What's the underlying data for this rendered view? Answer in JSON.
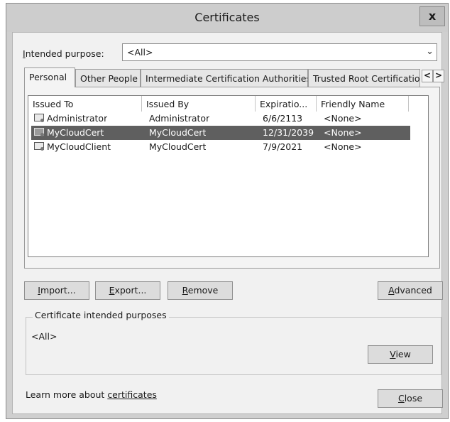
{
  "window": {
    "title": "Certificates",
    "close_glyph": "x"
  },
  "intended_purpose": {
    "label": "Intended purpose:",
    "value": "<All>"
  },
  "tabs": [
    {
      "label": "Personal",
      "active": true
    },
    {
      "label": "Other People",
      "active": false
    },
    {
      "label": "Intermediate Certification Authorities",
      "active": false
    },
    {
      "label": "Trusted Root Certification",
      "active": false
    }
  ],
  "tab_nav": {
    "prev": "<",
    "next": ">"
  },
  "table": {
    "columns": [
      "Issued To",
      "Issued By",
      "Expiratio...",
      "Friendly Name"
    ],
    "rows": [
      {
        "issued_to": "Administrator",
        "issued_by": "Administrator",
        "expiration": "6/6/2113",
        "friendly_name": "<None>",
        "selected": false
      },
      {
        "issued_to": "MyCloudCert",
        "issued_by": "MyCloudCert",
        "expiration": "12/31/2039",
        "friendly_name": "<None>",
        "selected": true
      },
      {
        "issued_to": "MyCloudClient",
        "issued_by": "MyCloudCert",
        "expiration": "7/9/2021",
        "friendly_name": "<None>",
        "selected": false
      }
    ]
  },
  "buttons": {
    "import": "Import...",
    "export": "Export...",
    "remove": "Remove",
    "advanced": "Advanced",
    "view": "View",
    "close": "Close"
  },
  "purposes_group": {
    "title": "Certificate intended purposes",
    "value": "<All>"
  },
  "footer": {
    "text": "Learn more about",
    "link": "certificates"
  },
  "icons": {
    "row_icon": "certificate-icon",
    "dropdown": "chevron-down-icon",
    "close": "close-icon"
  },
  "colors": {
    "selection": "#5f5f5f",
    "window_frame": "#cfcfcf",
    "dialog_body": "#f1f1f1"
  }
}
